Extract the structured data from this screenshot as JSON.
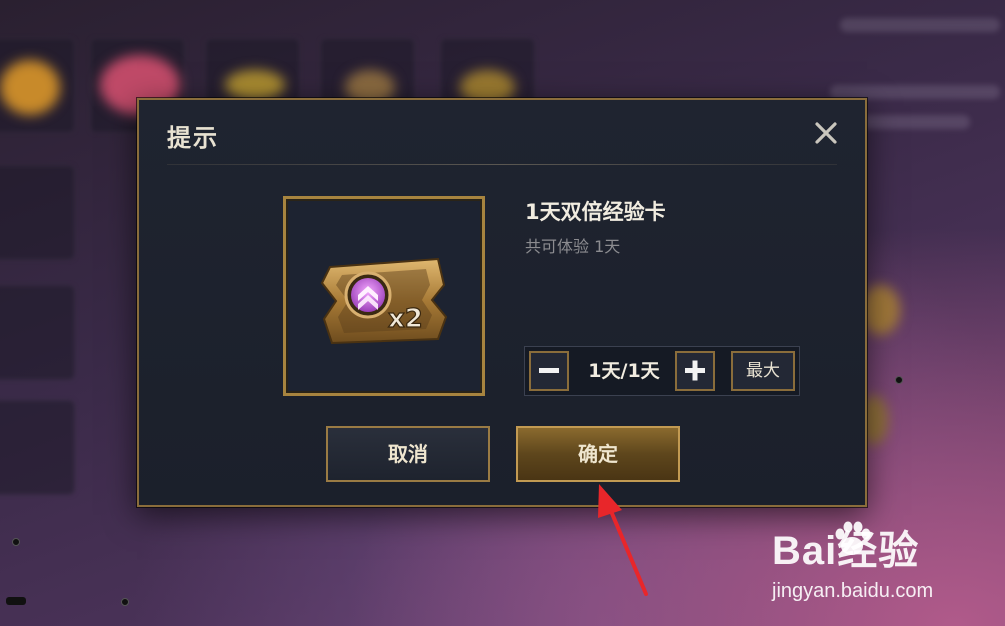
{
  "dialog": {
    "title": "提示",
    "item_name": "1天双倍经验卡",
    "item_desc": "共可体验 1天",
    "quantity": {
      "value": "1天/1天",
      "max_label": "最大"
    },
    "cancel_label": "取消",
    "confirm_label": "确定"
  },
  "item_badge": "x2",
  "watermark": {
    "brand": "Bai经验",
    "url": "jingyan.baidu.com"
  },
  "colors": {
    "accent_gold": "#a7843f",
    "annotation_red": "#e8262a",
    "dialog_bg": "#1f2430"
  },
  "icons": [
    "close-icon",
    "minus-icon",
    "plus-icon",
    "double-exp-card-icon",
    "baidu-paw-icon"
  ]
}
